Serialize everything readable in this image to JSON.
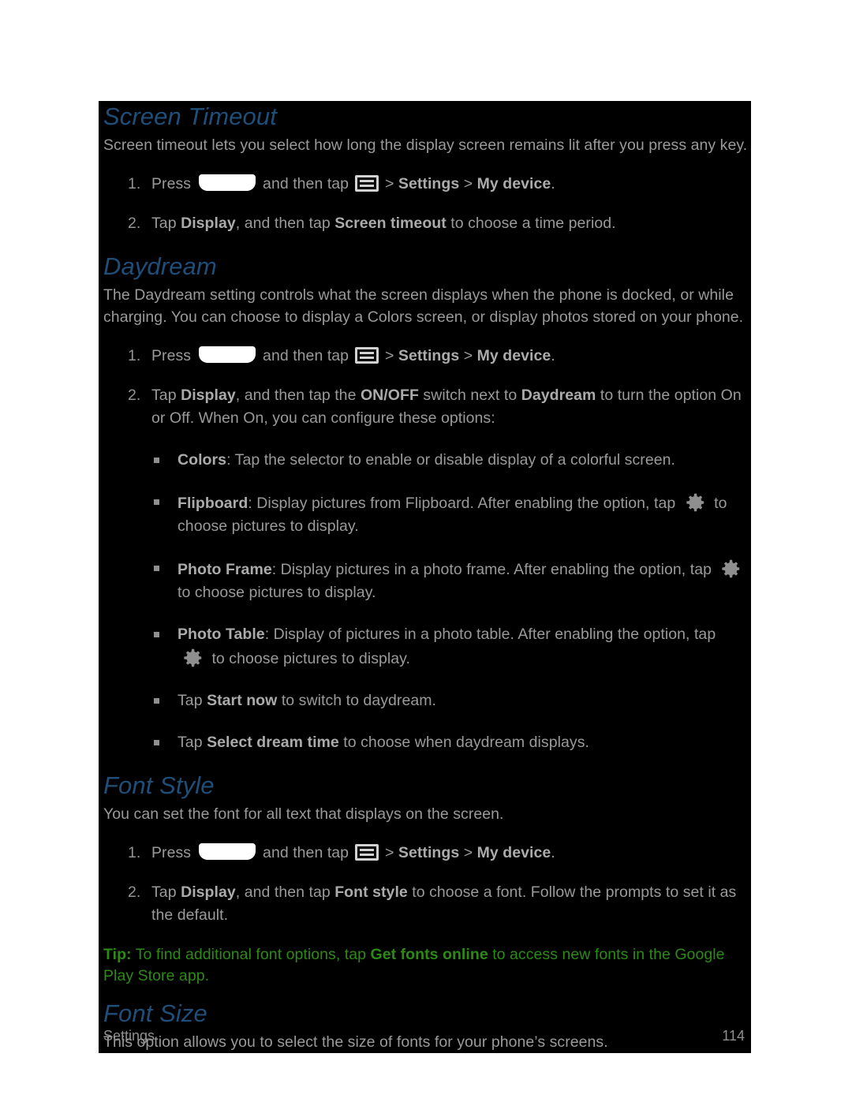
{
  "document": {
    "sections": [
      {
        "id": "screen-timeout",
        "heading": "Screen Timeout",
        "intro": "Screen timeout lets you select how long the display screen remains lit after you press any key.",
        "steps": [
          {
            "num": "1.",
            "pre": "Press ",
            "mid": " and then tap ",
            "post_bold_1": "Settings",
            "sep1": " > ",
            "post_bold_2": "My device",
            "end": ".",
            "gt": " > "
          },
          {
            "num": "2.",
            "a": "Tap ",
            "b1": "Display",
            "b": ", and then tap ",
            "b2": "Screen timeout",
            "c": " to choose a time period."
          }
        ]
      },
      {
        "id": "daydream",
        "heading": "Daydream",
        "intro": "The Daydream setting controls what the screen displays when the phone is docked, or while charging. You can choose to display a Colors screen, or display photos stored on your phone.",
        "steps": [
          {
            "num": "1.",
            "pre": "Press ",
            "mid": " and then tap ",
            "post_bold_1": "Settings",
            "gt": " > ",
            "post_bold_2": "My device",
            "end": "."
          },
          {
            "num": "2.",
            "a": "Tap ",
            "b1": "Display",
            "b": ", and then tap the ",
            "b2": "ON/OFF",
            "c": " switch next to ",
            "b3": "Daydream",
            "d": " to turn the option On or Off. When On, you can configure these options:"
          }
        ],
        "bullets": [
          {
            "label": "Colors",
            "text": ": Tap the selector to enable or disable display of a colorful screen."
          },
          {
            "label": "Flipboard",
            "text": ": Display pictures from Flipboard. After enabling the option, tap ",
            "icon": "gear-icon",
            "text_after": " to choose pictures to display."
          },
          {
            "label": "Photo Frame",
            "text": ": Display pictures in a photo frame. After enabling the option, tap ",
            "icon": "gear-icon",
            "text_after": " to choose pictures to display."
          },
          {
            "label": "Photo Table",
            "text": ": Display of pictures in a photo table. After enabling the option, tap ",
            "icon": "gear-icon",
            "text_after": " to choose pictures to display."
          },
          {
            "pre": "Tap ",
            "label": "Start now",
            "text": " to switch to daydream."
          },
          {
            "pre": "Tap ",
            "label": "Select dream time",
            "text": " to choose when daydream displays."
          }
        ]
      },
      {
        "id": "font-style",
        "heading": "Font Style",
        "intro": "You can set the font for all text that displays on the screen.",
        "steps": [
          {
            "num": "1.",
            "pre": "Press ",
            "mid": " and then tap ",
            "post_bold_1": "Settings",
            "gt": " > ",
            "post_bold_2": "My device",
            "end": "."
          },
          {
            "num": "2.",
            "a": "Tap ",
            "b1": "Display",
            "b": ", and then tap ",
            "b2": "Font style",
            "c": " to choose a font. Follow the prompts to set it as the default."
          }
        ],
        "tip": {
          "label": "Tip:",
          "part1": " To find additional font options, tap ",
          "bold": "Get fonts online",
          "part2": " to access new fonts in the Google Play Store app."
        }
      },
      {
        "id": "font-size",
        "heading": "Font Size",
        "intro": "This option allows you to select the size of fonts for your phone’s screens."
      }
    ]
  },
  "footer": {
    "chapter": "Settings",
    "page_number": "114"
  },
  "colors": {
    "panel_background": "#000000",
    "page_background": "#ffffff",
    "heading": "#1f4e79",
    "body_text": "#9a9a9a",
    "bold_text": "#ababab",
    "tip_green": "#2d8a14",
    "icon_gray": "#8f8f8f",
    "home_key": "#ffffff"
  },
  "icons": {
    "home_key": "home-key-icon",
    "menu": "menu-icon",
    "gear": "gear-icon"
  }
}
